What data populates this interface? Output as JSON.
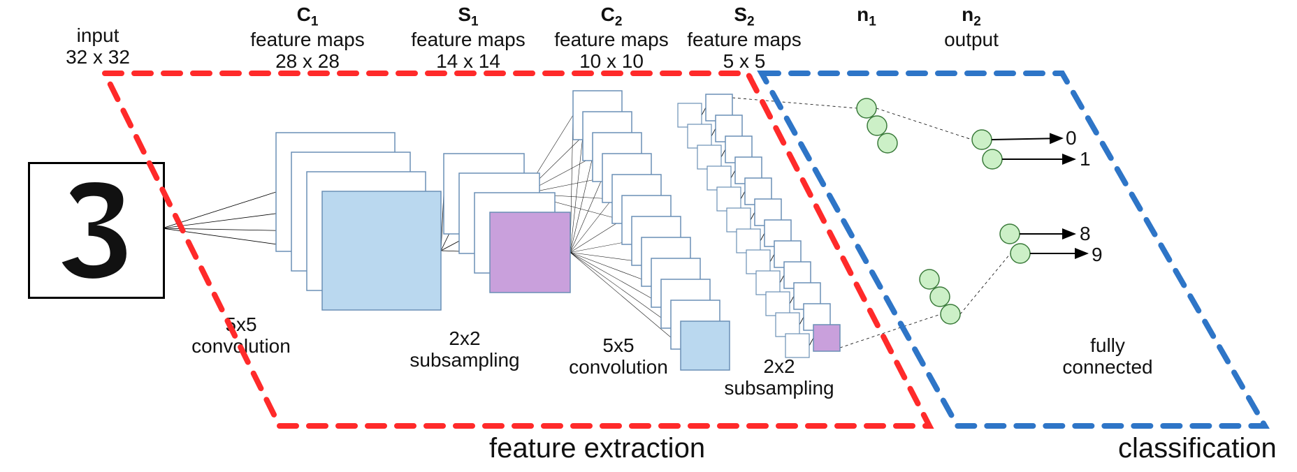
{
  "headers": {
    "input": {
      "title": "input",
      "dim": "32 x 32"
    },
    "c1": {
      "name_html": "C<span class='sub'>1</span>",
      "title": "feature maps",
      "dim": "28 x 28"
    },
    "s1": {
      "name_html": "S<span class='sub'>1</span>",
      "title": "feature maps",
      "dim": "14 x 14"
    },
    "c2": {
      "name_html": "C<span class='sub'>2</span>",
      "title": "feature maps",
      "dim": "10 x 10"
    },
    "s2": {
      "name_html": "S<span class='sub'>2</span>",
      "title": "feature maps",
      "dim": "5 x 5"
    },
    "n1": {
      "name_html": "n<span class='sub'>1</span>"
    },
    "n2": {
      "name_html": "n<span class='sub'>2</span>",
      "title": "output"
    }
  },
  "ops": {
    "conv1": "5x5\nconvolution",
    "sub1": "2x2\nsubsampling",
    "conv2": "5x5\nconvolution",
    "sub2": "2x2\nsubsampling",
    "fc": "fully\nconnected"
  },
  "regions": {
    "feature_extraction": "feature extraction",
    "classification": "classification"
  },
  "outputs": {
    "top": [
      "0",
      "1"
    ],
    "bottom": [
      "8",
      "9"
    ]
  },
  "colors": {
    "conv_fill": "#bad8ef",
    "pool_fill": "#c9a0dc",
    "neuron_fill": "#ccf0c7",
    "neuron_stroke": "#3a7a3a",
    "box_stroke": "#6a8fb5",
    "wire": "#000",
    "red": "#ff2a2a",
    "blue": "#2e75c7"
  },
  "input_glyph": "3",
  "architecture_data": {
    "type": "ConvNet",
    "layers": [
      {
        "id": "input",
        "kind": "input",
        "shape": [
          32,
          32
        ]
      },
      {
        "id": "C1",
        "kind": "conv",
        "kernel": [
          5,
          5
        ],
        "output": [
          28,
          28
        ],
        "maps": 4
      },
      {
        "id": "S1",
        "kind": "subsample",
        "kernel": [
          2,
          2
        ],
        "output": [
          14,
          14
        ],
        "maps": 4
      },
      {
        "id": "C2",
        "kind": "conv",
        "kernel": [
          5,
          5
        ],
        "output": [
          10,
          10
        ],
        "maps": 12
      },
      {
        "id": "S2",
        "kind": "subsample",
        "kernel": [
          2,
          2
        ],
        "output": [
          5,
          5
        ],
        "maps": 12
      },
      {
        "id": "n1",
        "kind": "hidden_fc",
        "units_shown": 6
      },
      {
        "id": "n2",
        "kind": "output",
        "classes": 10,
        "labels_shown": [
          "0",
          "1",
          "8",
          "9"
        ]
      }
    ],
    "regions": {
      "feature_extraction": [
        "C1",
        "S1",
        "C2",
        "S2"
      ],
      "classification": [
        "n1",
        "n2"
      ]
    }
  }
}
